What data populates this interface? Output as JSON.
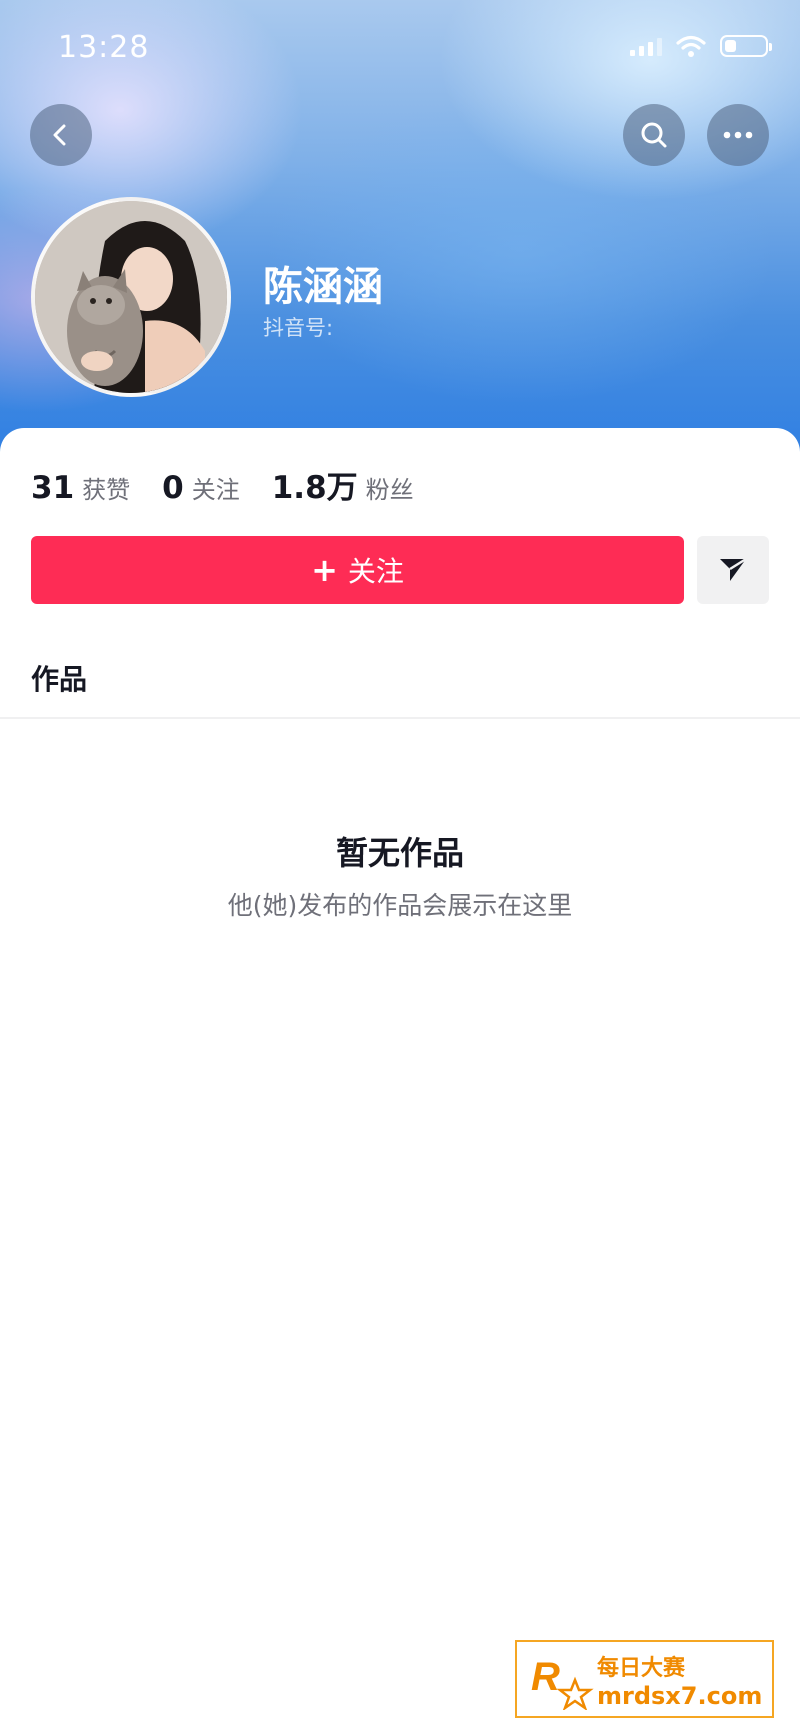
{
  "status_bar": {
    "time": "13:28"
  },
  "header": {
    "back_icon": "chevron-left-icon",
    "search_icon": "search-icon",
    "more_icon": "more-horizontal-icon"
  },
  "profile": {
    "name": "陈涵涵",
    "douyin_id_label": "抖音号:",
    "avatar_description": "avatar-photo"
  },
  "stats": [
    {
      "value": "31",
      "label": "获赞"
    },
    {
      "value": "0",
      "label": "关注"
    },
    {
      "value": "1.8万",
      "label": "粉丝"
    }
  ],
  "actions": {
    "follow_label": "关注",
    "follow_plus": "+",
    "message_icon": "send-icon"
  },
  "tabs": {
    "works": "作品"
  },
  "empty_state": {
    "title": "暂无作品",
    "description": "他(她)发布的作品会展示在这里"
  },
  "watermark": {
    "cn_text": "每日大赛",
    "url": "mrdsx7.com",
    "accent": "#f08a00"
  },
  "colors": {
    "primary": "#fe2c55",
    "text": "#161823",
    "secondary_text": "#6f7079"
  }
}
